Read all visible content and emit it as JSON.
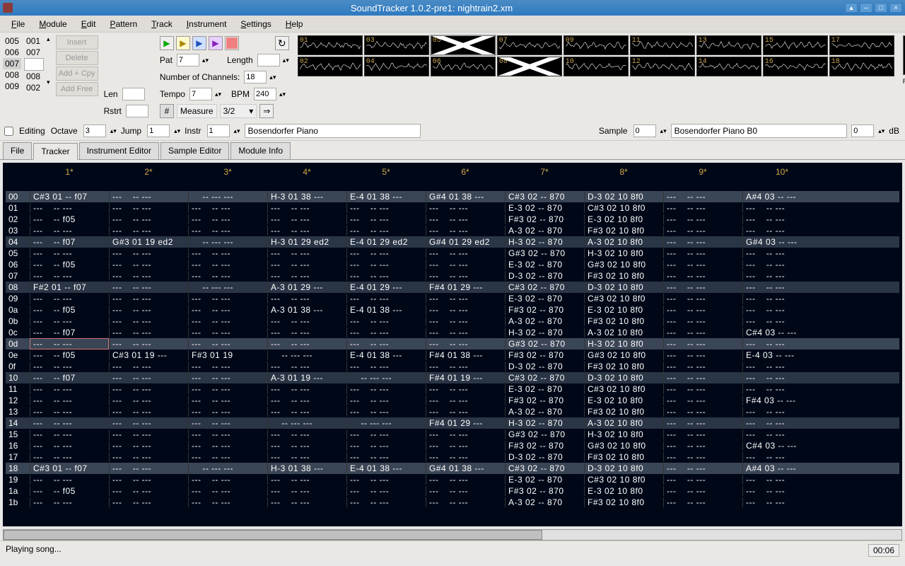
{
  "title": "SoundTracker 1.0.2-pre1: nightrain2.xm",
  "menus": [
    "File",
    "Module",
    "Edit",
    "Pattern",
    "Track",
    "Instrument",
    "Settings",
    "Help"
  ],
  "orderlist": {
    "col1": [
      "005",
      "006",
      "007",
      "008",
      "009"
    ],
    "col2": [
      "001",
      "007",
      "",
      "008",
      "002"
    ]
  },
  "ord_buttons": [
    "Insert",
    "Delete",
    "Add + Cpy",
    "Add Free"
  ],
  "len_label": "Len",
  "len_val": "",
  "rstrt_label": "Rstrt",
  "rstrt_val": "",
  "pat_label": "Pat",
  "pat_val": "7",
  "length_label": "Length",
  "length_val": "",
  "chan_label": "Number of Channels:",
  "chan_val": "18",
  "tempo_label": "Tempo",
  "tempo_val": "7",
  "bpm_label": "BPM",
  "bpm_val": "240",
  "sharp": "#",
  "measure_label": "Measure",
  "measure_val": "3/2",
  "wf_top": [
    "01",
    "03",
    "05",
    "07",
    "09",
    "11",
    "13",
    "15",
    "17"
  ],
  "wf_bot": [
    "02",
    "04",
    "06",
    "08",
    "10",
    "12",
    "14",
    "16",
    "18"
  ],
  "wf_muted": [
    "05",
    "08"
  ],
  "wf_selected": "05",
  "r_label": "R",
  "editing_label": "Editing",
  "octave_label": "Octave",
  "octave_val": "3",
  "jump_label": "Jump",
  "jump_val": "1",
  "instr_label": "Instr",
  "instr_val": "1",
  "instr_name": "Bosendorfer Piano",
  "sample_label": "Sample",
  "sample_val": "0",
  "sample_name": "Bosendorfer Piano B0",
  "db_val": "0",
  "db_label": "dB",
  "tabs": [
    "File",
    "Tracker",
    "Instrument Editor",
    "Sample Editor",
    "Module Info"
  ],
  "tab_active": "Tracker",
  "track_headers": [
    "1*",
    "2*",
    "3*",
    "4*",
    "5*",
    "6*",
    "7*",
    "8*",
    "9*",
    "10*"
  ],
  "rows": [
    "00",
    "01",
    "02",
    "03",
    "04",
    "05",
    "06",
    "07",
    "08",
    "09",
    "0a",
    "0b",
    "0c",
    "0d",
    "0e",
    "0f",
    "10",
    "11",
    "12",
    "13",
    "14",
    "15",
    "16",
    "17",
    "18",
    "19",
    "1a",
    "1b"
  ],
  "highlight_rows": [
    "00",
    "0d",
    "18"
  ],
  "sub_highlight": [
    "04",
    "08",
    "10",
    "14"
  ],
  "pattern_data": {
    "00": [
      "C#3 01 -- f07",
      "---    -- ---",
      "    -- --- ---",
      "H-3 01 38 ---",
      "E-4 01 38 ---",
      "G#4 01 38 ---",
      "C#3 02 -- 870",
      "D-3 02 10 8f0",
      "---    -- ---",
      "A#4 03 -- ---"
    ],
    "01": [
      "---    -- ---",
      "",
      "",
      "",
      "",
      "",
      "E-3 02 -- 870",
      "C#3 02 10 8f0",
      "---    -- ---",
      "---    -- ---"
    ],
    "02": [
      "---    -- f05",
      "",
      "",
      "",
      "",
      "",
      "F#3 02 -- 870",
      "E-3 02 10 8f0",
      "---    -- ---",
      "---    -- ---"
    ],
    "03": [
      "---    -- ---",
      "",
      "",
      "",
      "",
      "",
      "A-3 02 -- 870",
      "F#3 02 10 8f0",
      "---    -- ---",
      "---    -- ---"
    ],
    "04": [
      "---    -- f07",
      "G#3 01 19 ed2",
      "    -- --- ---",
      "H-3 01 29 ed2",
      "E-4 01 29 ed2",
      "G#4 01 29 ed2",
      "H-3 02 -- 870",
      "A-3 02 10 8f0",
      "---    -- ---",
      "G#4 03 -- ---"
    ],
    "05": [
      "---    -- ---",
      "",
      "",
      "",
      "",
      "",
      "G#3 02 -- 870",
      "H-3 02 10 8f0",
      "---    -- ---",
      "---    -- ---"
    ],
    "06": [
      "---    -- f05",
      "",
      "",
      "",
      "",
      "",
      "E-3 02 -- 870",
      "G#3 02 10 8f0",
      "---    -- ---",
      "---    -- ---"
    ],
    "07": [
      "---    -- ---",
      "",
      "",
      "",
      "",
      "",
      "D-3 02 -- 870",
      "F#3 02 10 8f0",
      "---    -- ---",
      "---    -- ---"
    ],
    "08": [
      "F#2 01 -- f07",
      "---    -- ---",
      "    -- --- ---",
      "A-3 01 29 ---",
      "E-4 01 29 ---",
      "F#4 01 29 ---",
      "C#3 02 -- 870",
      "D-3 02 10 8f0",
      "---    -- ---",
      "---    -- ---"
    ],
    "09": [
      "---    -- ---",
      "",
      "",
      "",
      "",
      "",
      "E-3 02 -- 870",
      "C#3 02 10 8f0",
      "---    -- ---",
      "---    -- ---"
    ],
    "0a": [
      "---    -- f05",
      "",
      "",
      "A-3 01 38 ---",
      "E-4 01 38 ---",
      "",
      "F#3 02 -- 870",
      "E-3 02 10 8f0",
      "---    -- ---",
      "---    -- ---"
    ],
    "0b": [
      "---    -- ---",
      "",
      "",
      "",
      "",
      "",
      "A-3 02 -- 870",
      "F#3 02 10 8f0",
      "---    -- ---",
      "---    -- ---"
    ],
    "0c": [
      "---    -- f07",
      "",
      "",
      "",
      "",
      "",
      "H-3 02 -- 870",
      "A-3 02 10 8f0",
      "---    -- ---",
      "C#4 03 -- ---"
    ],
    "0d": [
      "---    -- ---",
      "",
      "",
      "",
      "",
      "",
      "G#3 02 -- 870",
      "H-3 02 10 8f0",
      "---    -- ---",
      "---    -- ---"
    ],
    "0e": [
      "---    -- f05",
      "C#3 01 19 ---",
      "F#3 01 19    ",
      "    -- --- ---",
      "E-4 01 38 ---",
      "F#4 01 38 ---",
      "F#3 02 -- 870",
      "G#3 02 10 8f0",
      "---    -- ---",
      "E-4 03 -- ---"
    ],
    "0f": [
      "---    -- ---",
      "",
      "",
      "",
      "",
      "",
      "D-3 02 -- 870",
      "F#3 02 10 8f0",
      "---    -- ---",
      "---    -- ---"
    ],
    "10": [
      "---    -- f07",
      "",
      "",
      "A-3 01 19 ---",
      "    -- --- ---",
      "F#4 01 19 ---",
      "C#3 02 -- 870",
      "D-3 02 10 8f0",
      "---    -- ---",
      "---    -- ---"
    ],
    "11": [
      "---    -- ---",
      "",
      "",
      "",
      "",
      "",
      "E-3 02 -- 870",
      "C#3 02 10 8f0",
      "---    -- ---",
      "---    -- ---"
    ],
    "12": [
      "---    -- ---",
      "",
      "",
      "",
      "",
      "",
      "F#3 02 -- 870",
      "E-3 02 10 8f0",
      "---    -- ---",
      "F#4 03 -- ---"
    ],
    "13": [
      "---    -- ---",
      "",
      "",
      "",
      "",
      "",
      "A-3 02 -- 870",
      "F#3 02 10 8f0",
      "---    -- ---",
      "---    -- ---"
    ],
    "14": [
      "---    -- ---",
      "",
      "",
      "    -- --- ---",
      "    -- --- ---",
      "F#4 01 29 ---",
      "H-3 02 -- 870",
      "A-3 02 10 8f0",
      "---    -- ---",
      "---    -- ---"
    ],
    "15": [
      "---    -- ---",
      "",
      "",
      "",
      "",
      "",
      "G#3 02 -- 870",
      "H-3 02 10 8f0",
      "---    -- ---",
      "---    -- ---"
    ],
    "16": [
      "---    -- ---",
      "",
      "",
      "",
      "",
      "",
      "F#3 02 -- 870",
      "G#3 02 10 8f0",
      "---    -- ---",
      "C#4 03 -- ---"
    ],
    "17": [
      "---    -- ---",
      "",
      "",
      "",
      "",
      "",
      "D-3 02 -- 870",
      "F#3 02 10 8f0",
      "---    -- ---",
      "---    -- ---"
    ],
    "18": [
      "C#3 01 -- f07",
      "---    -- ---",
      "    -- --- ---",
      "H-3 01 38 ---",
      "E-4 01 38 ---",
      "G#4 01 38 ---",
      "C#3 02 -- 870",
      "D-3 02 10 8f0",
      "---    -- ---",
      "A#4 03 -- ---"
    ],
    "19": [
      "---    -- ---",
      "",
      "",
      "",
      "",
      "",
      "E-3 02 -- 870",
      "C#3 02 10 8f0",
      "---    -- ---",
      "---    -- ---"
    ],
    "1a": [
      "---    -- f05",
      "",
      "",
      "",
      "",
      "",
      "F#3 02 -- 870",
      "E-3 02 10 8f0",
      "---    -- ---",
      "---    -- ---"
    ],
    "1b": [
      "---    -- ---",
      "",
      "",
      "",
      "",
      "",
      "A-3 02 -- 870",
      "F#3 02 10 8f0",
      "---    -- ---",
      "---    -- ---"
    ]
  },
  "cursor_row": "0d",
  "cursor_col": 0,
  "status": "Playing song...",
  "time": "00:06"
}
